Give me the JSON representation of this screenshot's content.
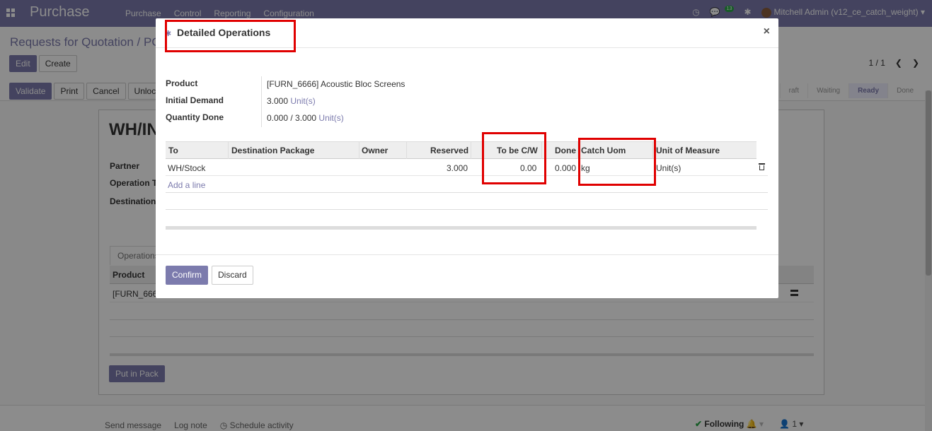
{
  "app": {
    "brand": "Purchase",
    "menu": [
      "Purchase",
      "Control",
      "Reporting",
      "Configuration"
    ],
    "chat_count": "13",
    "user": "Mitchell Admin (v12_ce_catch_weight)"
  },
  "breadcrumb": "Requests for Quotation / PO",
  "toolbar": {
    "edit": "Edit",
    "create": "Create",
    "validate": "Validate",
    "print": "Print",
    "cancel": "Cancel",
    "unlock": "Unlock"
  },
  "pager": "1 / 1",
  "stages": [
    "raft",
    "Waiting",
    "Ready",
    "Done"
  ],
  "sheet": {
    "title": "WH/IN",
    "labels": [
      "Partner",
      "Operation T",
      "Destination"
    ],
    "tab": "Operations",
    "column": "Product",
    "row": "[FURN_666",
    "put_in_pack": "Put in Pack"
  },
  "chatter": {
    "send_message": "Send message",
    "log_note": "Log note",
    "schedule": "Schedule activity",
    "following": "Following",
    "followers": "1"
  },
  "modal": {
    "title": "Detailed Operations",
    "close": "×",
    "product_label": "Product",
    "product_value": "[FURN_6666] Acoustic Bloc Screens",
    "demand_label": "Initial Demand",
    "demand_qty": "3.000",
    "demand_uom": "Unit(s)",
    "done_label": "Quantity Done",
    "done_qty": "0.000 / 3.000",
    "done_uom": "Unit(s)",
    "columns": {
      "to": "To",
      "dest_package": "Destination Package",
      "owner": "Owner",
      "reserved": "Reserved",
      "to_be_cw": "To be C/W",
      "done": "Done",
      "catch_uom": "Catch Uom",
      "uom": "Unit of Measure"
    },
    "row": {
      "to": "WH/Stock",
      "reserved": "3.000",
      "to_be_cw": "0.00",
      "done": "0.000",
      "catch_uom": "kg",
      "uom": "Unit(s)"
    },
    "add_line": "Add a line",
    "confirm": "Confirm",
    "discard": "Discard"
  },
  "colors": {
    "brand": "#7c7bad",
    "highlight": "#e00000"
  }
}
